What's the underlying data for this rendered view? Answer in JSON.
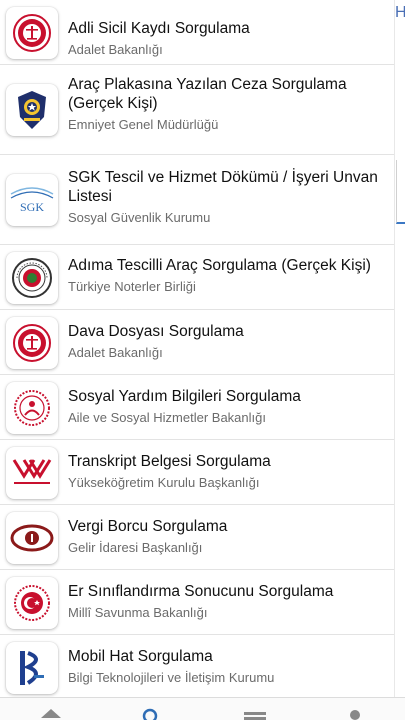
{
  "items": [
    {
      "title": "Adli Sicil Kaydı Sorgulama",
      "subtitle": "Adalet Bakanlığı",
      "logo": "adalet-logo-icon"
    },
    {
      "title": "Araç Plakasına Yazılan Ceza Sorgulama (Gerçek Kişi)",
      "subtitle": "Emniyet Genel Müdürlüğü",
      "logo": "emniyet-logo-icon"
    },
    {
      "title": "SGK Tescil ve Hizmet Dökümü / İşyeri Unvan Listesi",
      "subtitle": "Sosyal Güvenlik Kurumu",
      "logo": "sgk-logo-icon",
      "logo_text": "SGK"
    },
    {
      "title": "Adıma Tescilli Araç Sorgulama (Gerçek Kişi)",
      "subtitle": "Türkiye Noterler Birliği",
      "logo": "noterler-logo-icon"
    },
    {
      "title": "Dava Dosyası Sorgulama",
      "subtitle": "Adalet Bakanlığı",
      "logo": "adalet-logo-icon"
    },
    {
      "title": "Sosyal Yardım Bilgileri Sorgulama",
      "subtitle": "Aile ve Sosyal Hizmetler Bakanlığı",
      "logo": "aile-bakanligi-logo-icon"
    },
    {
      "title": "Transkript Belgesi Sorgulama",
      "subtitle": "Yükseköğretim Kurulu Başkanlığı",
      "logo": "yok-logo-icon"
    },
    {
      "title": "Vergi Borcu Sorgulama",
      "subtitle": "Gelir İdaresi Başkanlığı",
      "logo": "gib-logo-icon"
    },
    {
      "title": "Er Sınıflandırma Sonucunu Sorgulama",
      "subtitle": "Millî Savunma Bakanlığı",
      "logo": "msb-logo-icon"
    },
    {
      "title": "Mobil Hat Sorgulama",
      "subtitle": "Bilgi Teknolojileri ve İletişim Kurumu",
      "logo": "btk-logo-icon"
    }
  ],
  "right_panel": {
    "letter": "H"
  },
  "colors": {
    "accent": "#2f6db5",
    "red": "#c8102e"
  },
  "tabbar": [
    {
      "icon": "home-icon"
    },
    {
      "icon": "search-icon"
    },
    {
      "icon": "list-icon"
    },
    {
      "icon": "profile-icon"
    }
  ]
}
